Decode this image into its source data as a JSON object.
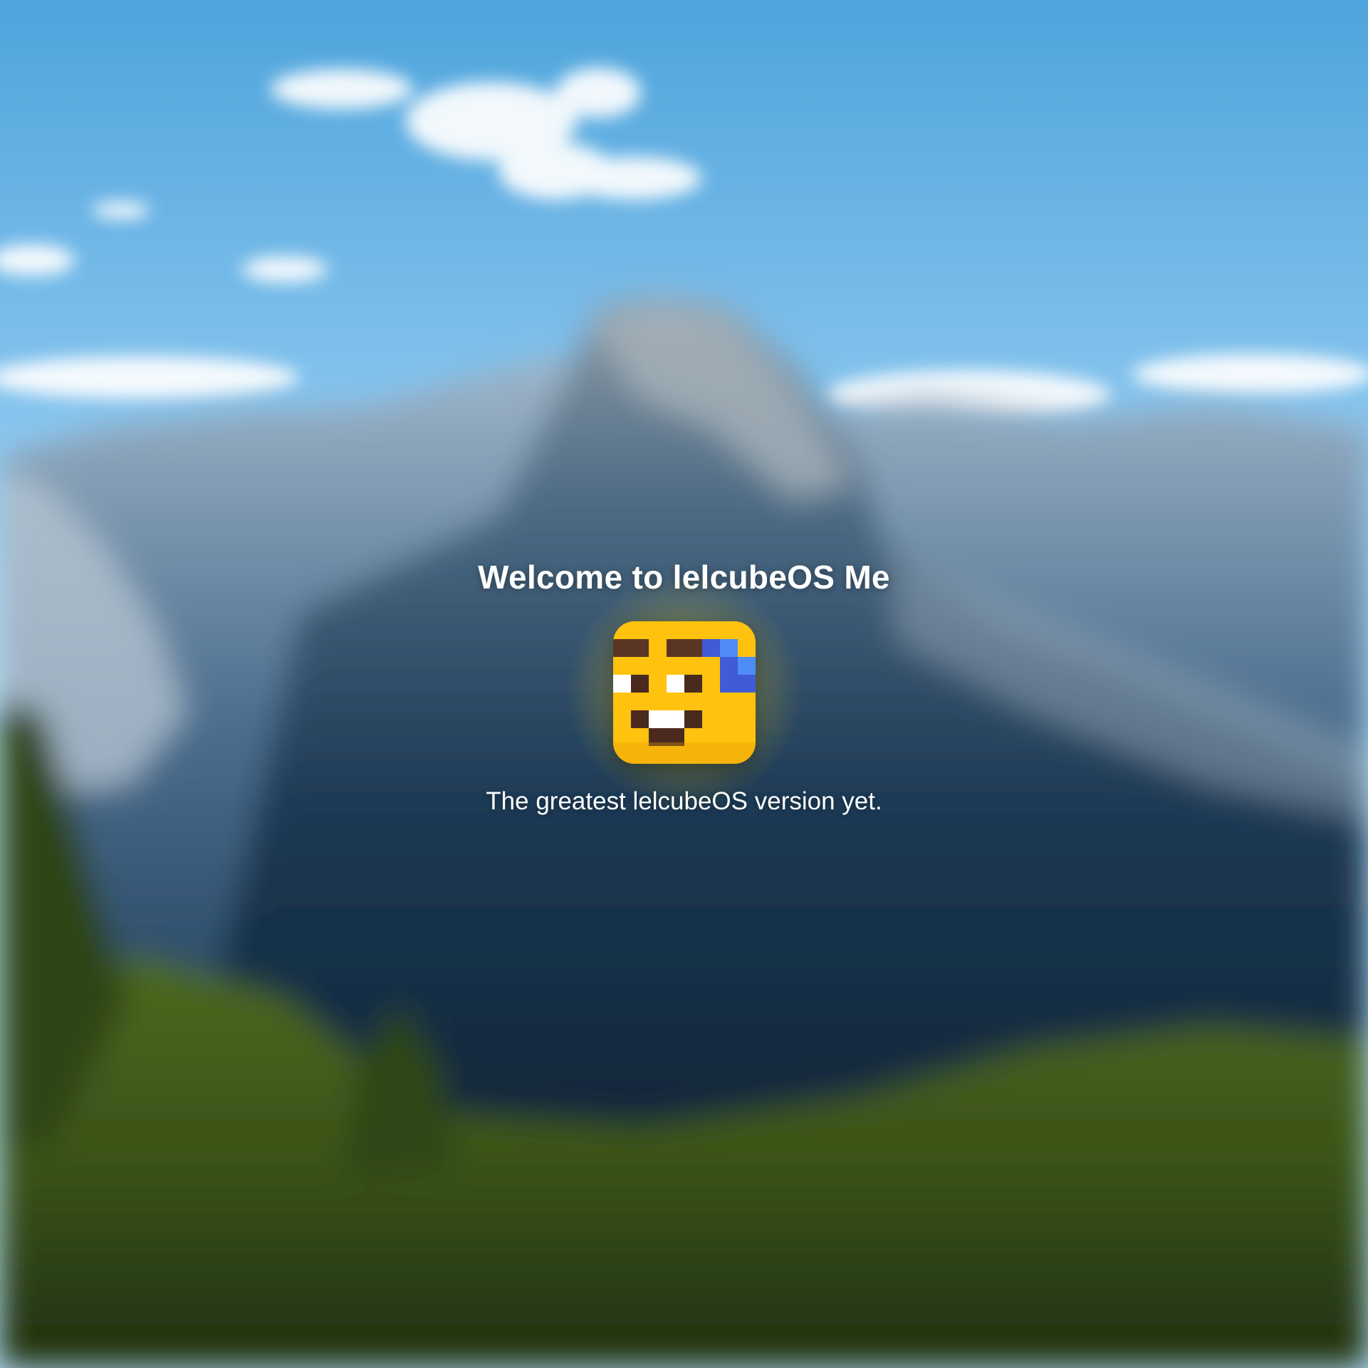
{
  "welcome": {
    "title": "Welcome to lelcubeOS Me",
    "subtitle": "The greatest lelcubeOS version yet."
  },
  "logo": {
    "icon": "lelcube-pixel-face-icon",
    "colors": {
      "face": "#ffc20e",
      "brows": "#5a3523",
      "eye_white": "#ffffff",
      "eye_pupil": "#4a2a1e",
      "mouth": "#4a2a1e",
      "teeth": "#ffffff",
      "hair_light": "#4f8cf5",
      "hair_dark": "#3f5bd6"
    }
  },
  "wallpaper": {
    "subject": "blurred-mountain-landscape",
    "colors": {
      "sky_top": "#4fa5dd",
      "sky_bottom": "#a9d8f6",
      "mountain": "#2c4d68",
      "forest": "#3d5a1c"
    }
  }
}
